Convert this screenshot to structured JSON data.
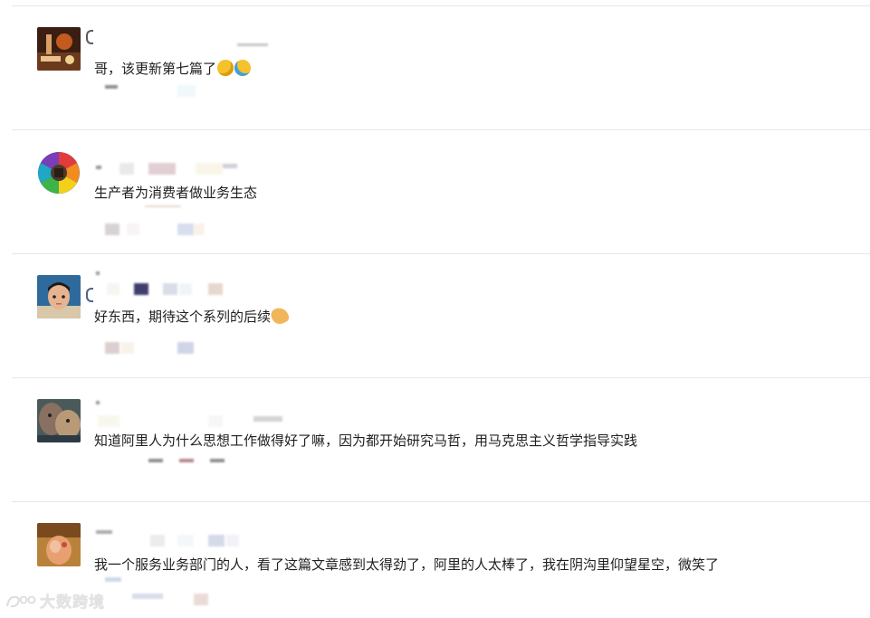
{
  "comments": [
    {
      "text": "哥，该更新第七篇了",
      "emojis": [
        "wink-tongue-emoji",
        "sweat-emoji"
      ]
    },
    {
      "text": "生产者为消费者做业务生态",
      "emojis": []
    },
    {
      "text": "好东西，期待这个系列的后续",
      "emojis": [
        "clap-hands-emoji"
      ]
    },
    {
      "text": "知道阿里人为什么思想工作做得好了嘛，因为都开始研究马哲，用马克思主义哲学指导实践",
      "emojis": []
    },
    {
      "text": "我一个服务业务部门的人，看了这篇文章感到太得劲了，阿里的人太棒了，我在阴沟里仰望星空，微笑了",
      "emojis": []
    }
  ],
  "watermark": {
    "text": "大数跨境"
  },
  "colors": {
    "divider": "#e6e6e6",
    "text": "#1f1f1f",
    "emoji": "#f5c22b",
    "watermark": "#e3e3e3"
  }
}
